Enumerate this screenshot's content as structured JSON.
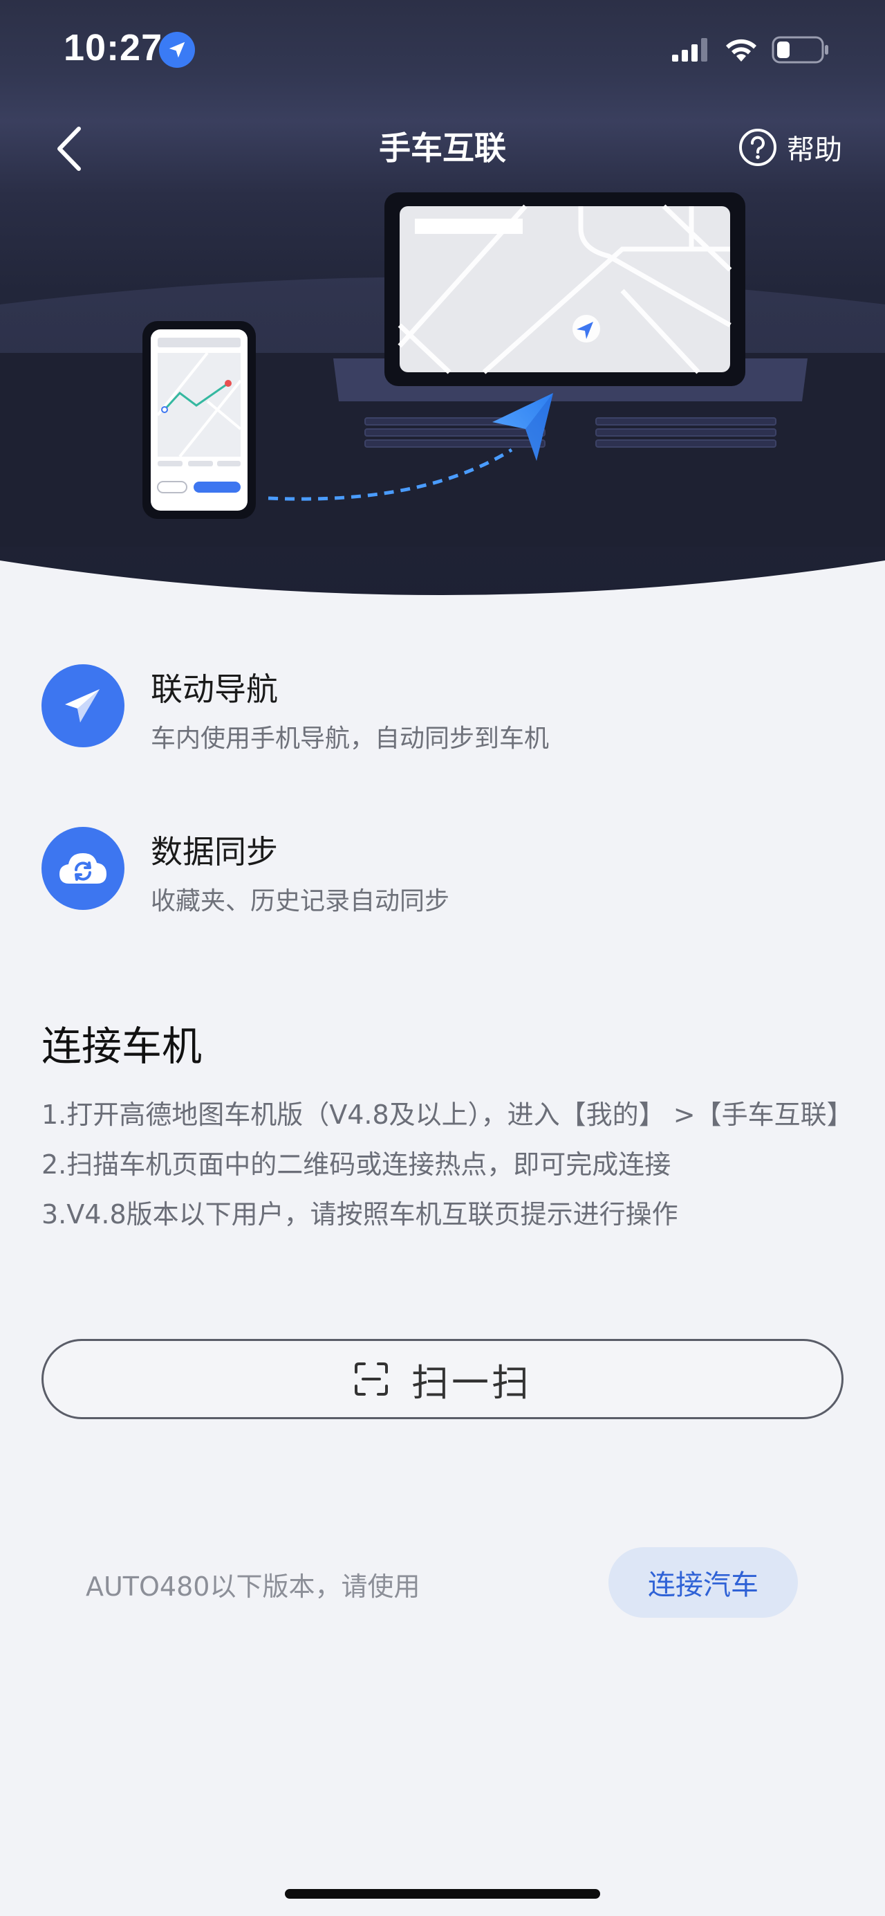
{
  "status_bar": {
    "time": "10:27",
    "location_icon": "location-arrow-icon",
    "signal_icon": "cellular-signal-icon",
    "wifi_icon": "wifi-icon",
    "battery_icon": "battery-icon"
  },
  "navbar": {
    "title": "手车互联",
    "back_icon": "chevron-left-icon",
    "help_label": "帮助",
    "help_icon": "question-circle-icon"
  },
  "features": [
    {
      "icon": "paper-plane-icon",
      "title": "联动导航",
      "desc": "车内使用手机导航，自动同步到车机"
    },
    {
      "icon": "cloud-sync-icon",
      "title": "数据同步",
      "desc": "收藏夹、历史记录自动同步"
    }
  ],
  "connect": {
    "title": "连接车机",
    "steps": [
      "1.打开高德地图车机版（V4.8及以上），进入【我的】 >【手车互联】",
      "2.扫描车机页面中的二维码或连接热点，即可完成连接",
      "3.V4.8版本以下用户，请按照车机互联页提示进行操作"
    ]
  },
  "scan_button": {
    "label": "扫一扫",
    "icon": "scan-icon"
  },
  "legacy": {
    "text": "AUTO480以下版本，请使用",
    "button_label": "连接汽车"
  },
  "colors": {
    "accent": "#3d76f0",
    "header_dark": "#2c3047",
    "link_blue": "#2f62d6"
  }
}
